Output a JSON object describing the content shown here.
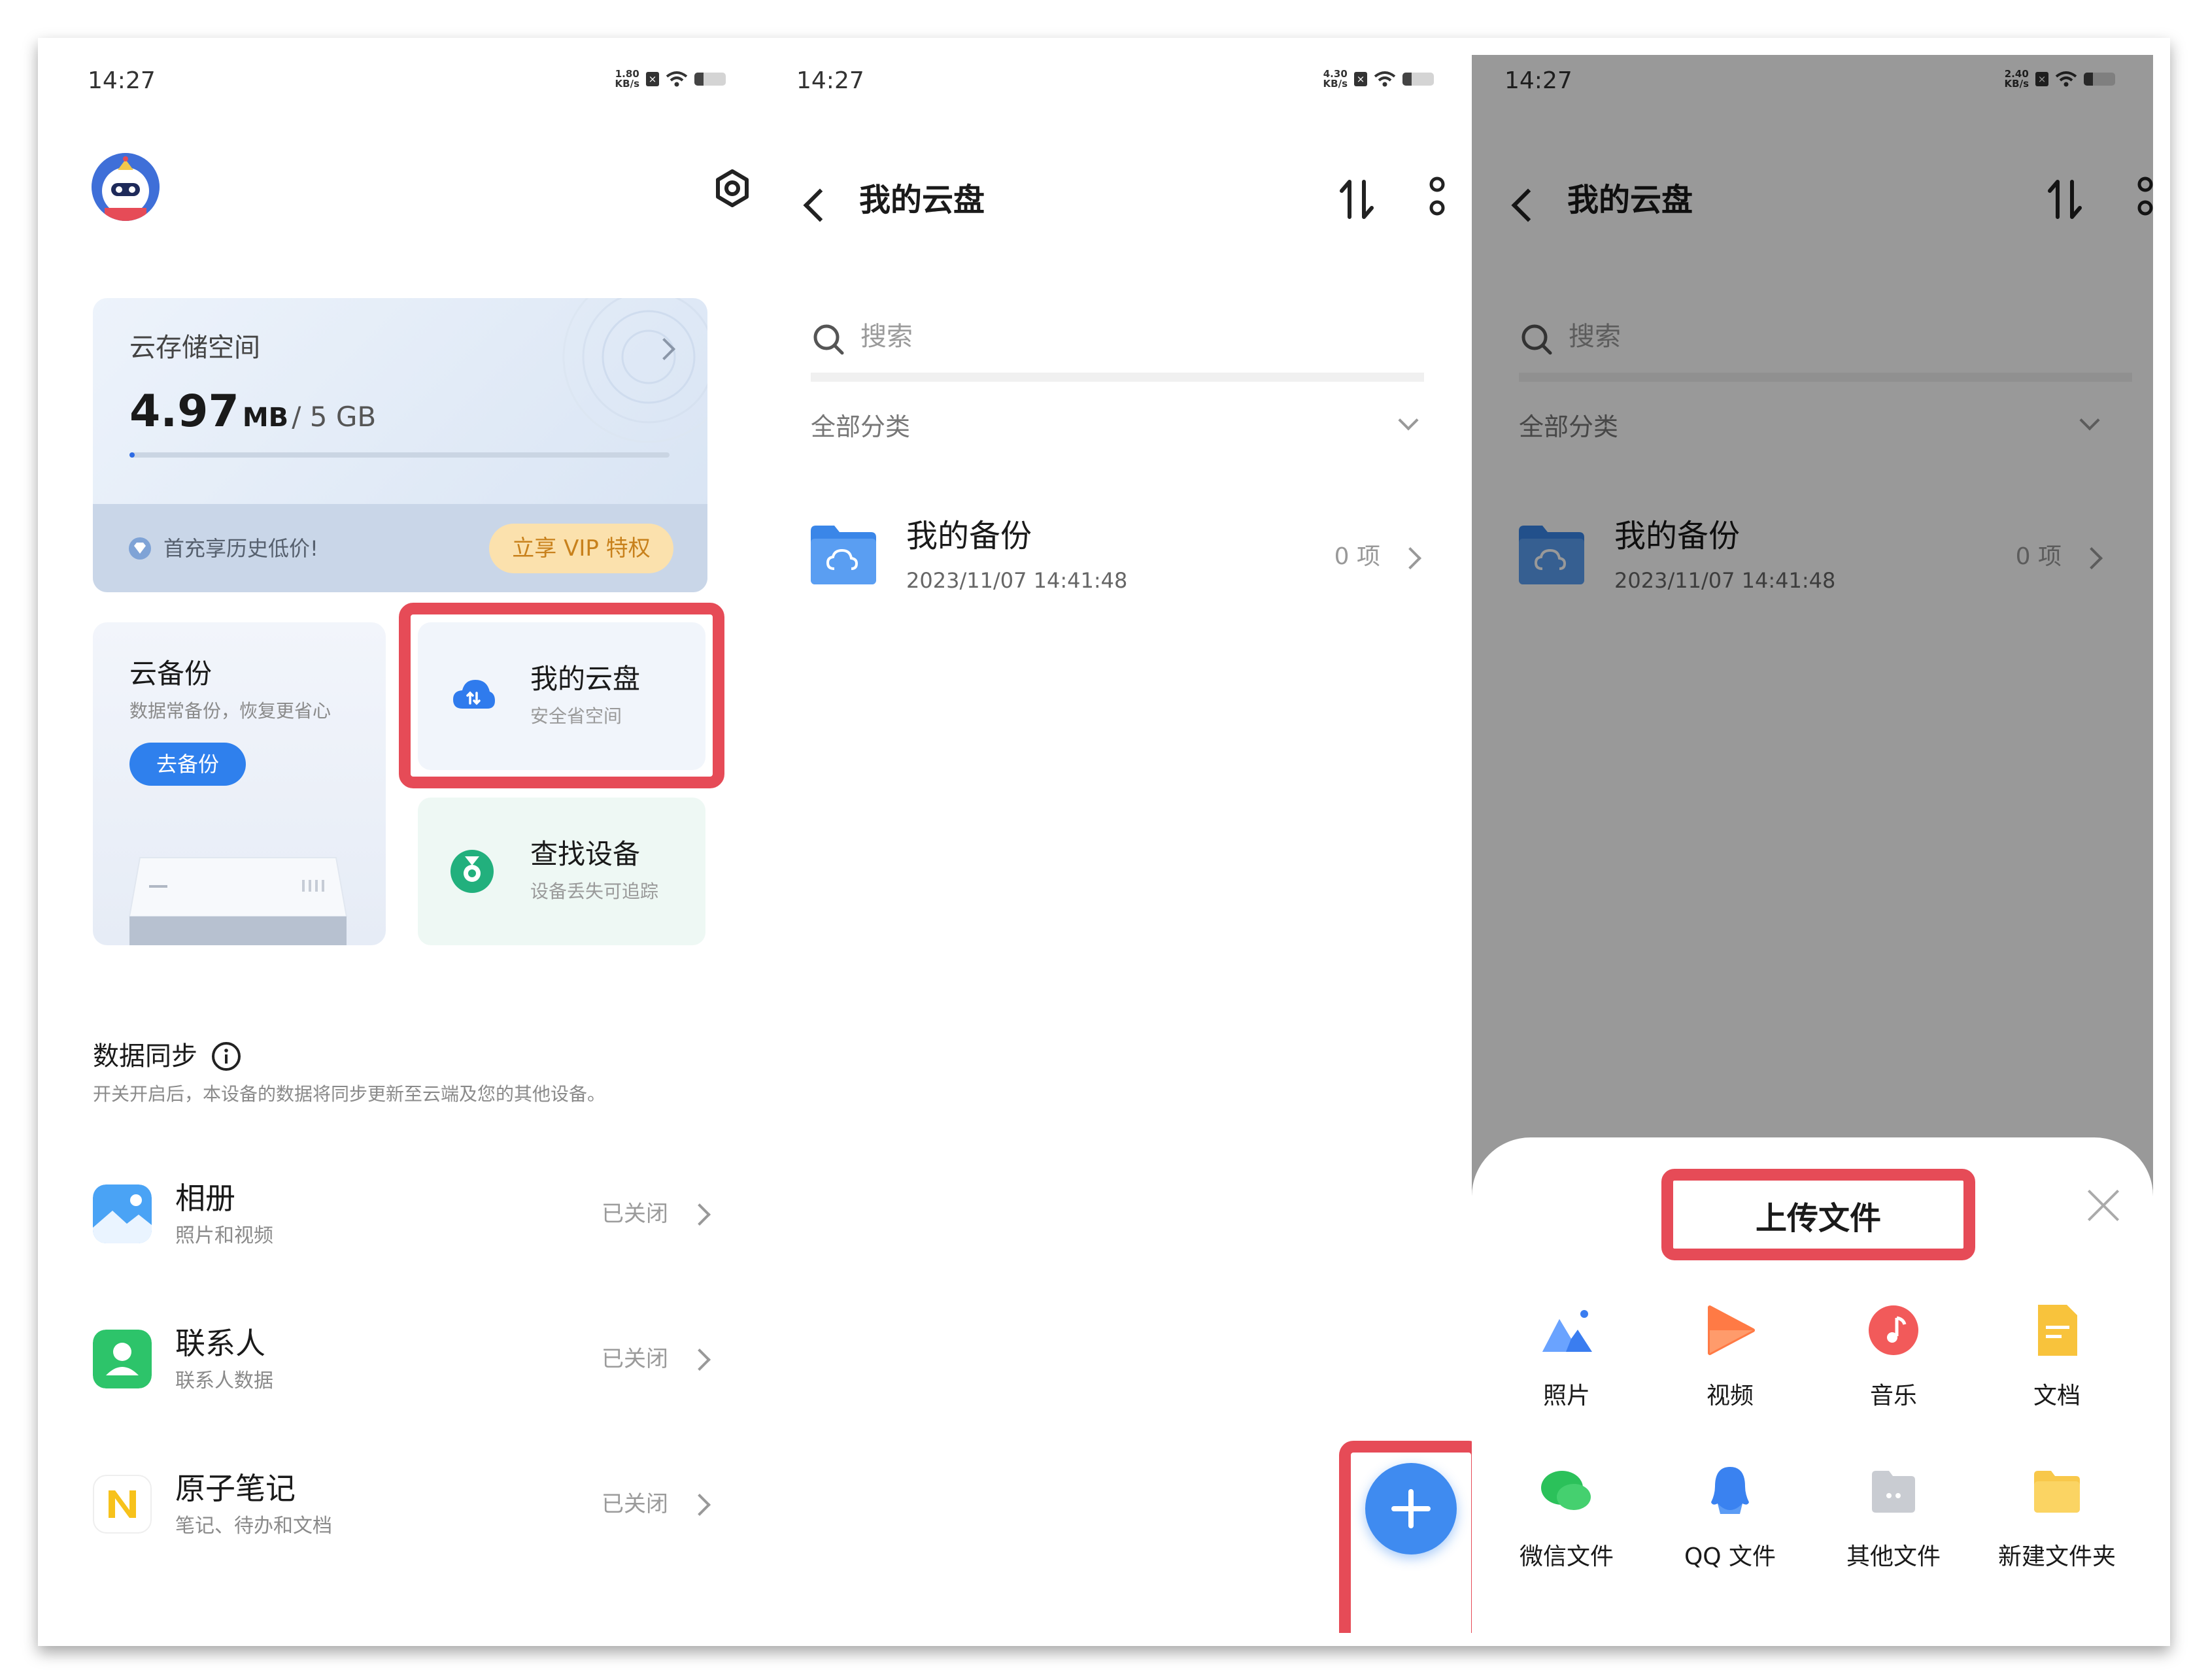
{
  "status_bar": {
    "time": "14:27",
    "panels": [
      {
        "net_speed": "1.80",
        "net_unit": "KB/s",
        "battery_level": 0.3
      },
      {
        "net_speed": "4.30",
        "net_unit": "KB/s",
        "battery_level": 0.3
      },
      {
        "net_speed": "2.40",
        "net_unit": "KB/s",
        "battery_level": 0.3
      }
    ]
  },
  "home": {
    "storage": {
      "title": "云存储空间",
      "used_value": "4.97",
      "used_unit": "MB",
      "total": "/ 5 GB",
      "used_fraction": 0.001,
      "promo_text": "首充享历史低价!",
      "vip_button": "立享 VIP 特权"
    },
    "backup": {
      "title": "云备份",
      "subtitle": "数据常备份，恢复更省心",
      "button": "去备份"
    },
    "my_cloud": {
      "title": "我的云盘",
      "subtitle": "安全省空间"
    },
    "find_device": {
      "title": "查找设备",
      "subtitle": "设备丢失可追踪"
    },
    "sync": {
      "title": "数据同步",
      "description": "开关开启后，本设备的数据将同步更新至云端及您的其他设备。",
      "items": [
        {
          "title": "相册",
          "subtitle": "照片和视频",
          "status": "已关闭"
        },
        {
          "title": "联系人",
          "subtitle": "联系人数据",
          "status": "已关闭"
        },
        {
          "title": "原子笔记",
          "subtitle": "笔记、待办和文档",
          "status": "已关闭"
        }
      ]
    }
  },
  "cloud_drive": {
    "title": "我的云盘",
    "search_placeholder": "搜索",
    "category": "全部分类",
    "folder": {
      "name": "我的备份",
      "date": "2023/11/07 14:41:48",
      "count": "0 项"
    }
  },
  "upload_sheet": {
    "title": "上传文件",
    "options": [
      "照片",
      "视频",
      "音乐",
      "文档",
      "微信文件",
      "QQ 文件",
      "其他文件",
      "新建文件夹"
    ]
  },
  "colors": {
    "accent": "#2f80ed",
    "highlight": "#e64b57",
    "vip_bg": "#fbe1ad",
    "vip_text": "#c8811c"
  }
}
